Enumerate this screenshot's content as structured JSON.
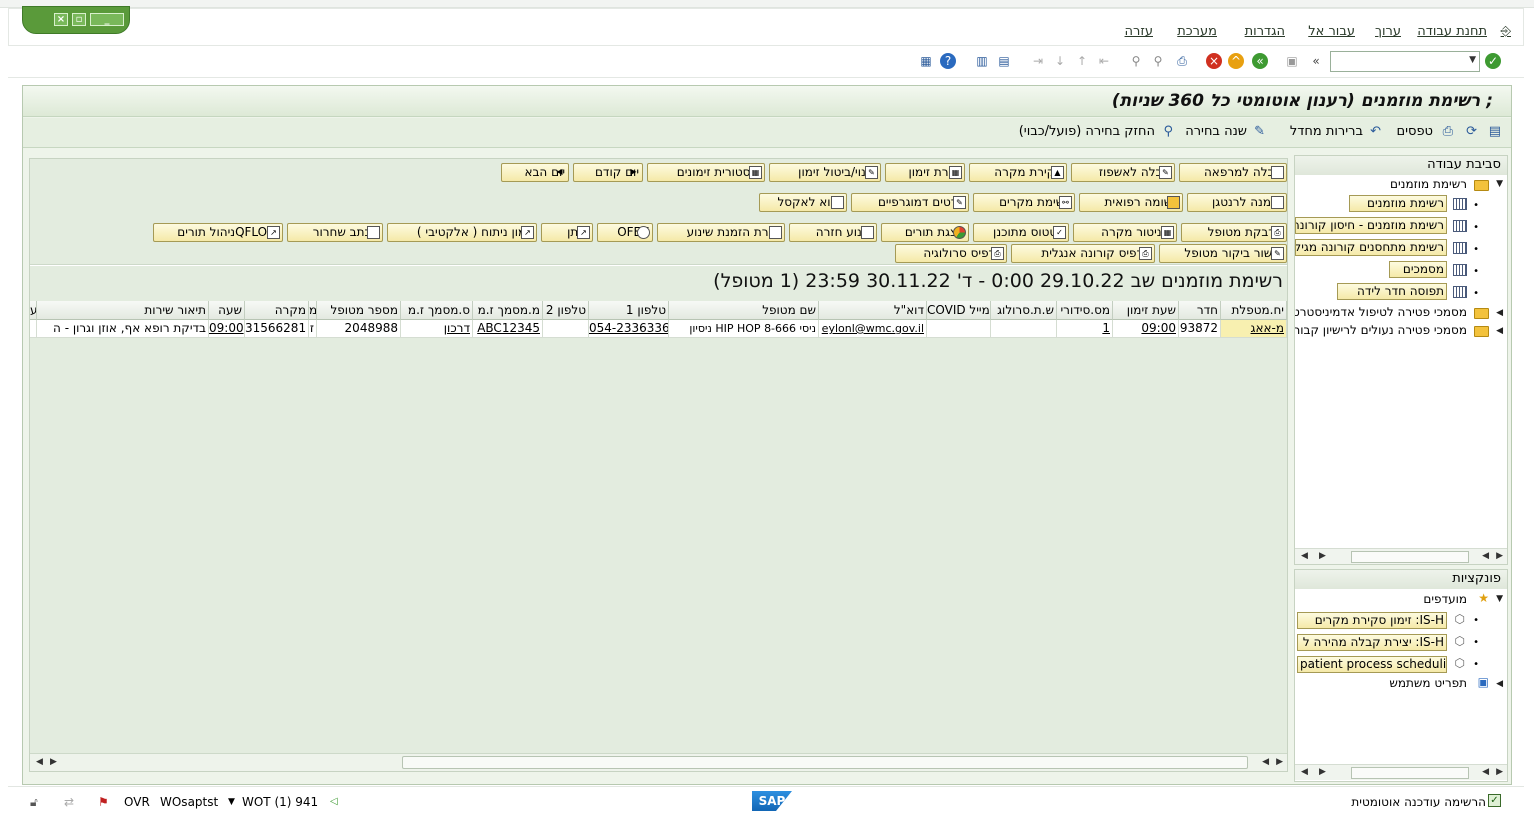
{
  "menu": {
    "items": [
      "תחנת עבודה",
      "ערוך",
      "עבור אל",
      "הגדרות",
      "מערכת",
      "עזרה"
    ]
  },
  "title": "רשימת מוזמנים (רענון אוטומטי כל 360 שניות)  ;",
  "app_toolbar": {
    "items": [
      "טפסים",
      "ברירות מחדל",
      "שנה בחירה",
      "החזק בחירה (פועל/כבוי)"
    ]
  },
  "buttons": {
    "row1": [
      "קבלה למרפאה",
      "קבלה לאשפוז",
      "סקירת מקרה",
      "יצירת זימון",
      "שינוי/ביטול זימון",
      "היסטורית זימונים",
      "יום קודם",
      "יום הבא"
    ],
    "row2": [
      "הזמנה לרנטגן",
      "רשומה רפואית",
      "רשימת מקרים",
      "פרטים דמוגרפיים",
      "ייצוא לאקסל"
    ],
    "row3": [
      "מדבקת מטופל",
      "מוניטור מקרה",
      "סטטוס מתוכנן",
      "הצגת תורים",
      "שינוע חזרה",
      "יצירת הזמנת שינוע",
      "OFEK",
      "איתן",
      "זימון ניתוח ( אלקטיבי )",
      "מכתב שחרור",
      "QFLOWניהול תורים"
    ],
    "row4": [
      "אישור ביקור מטופל",
      "תדפיס קורונה אנגלית",
      "תדפיס סרולוגיה"
    ]
  },
  "list": {
    "heading": "רשימת מוזמנים שב 29.10.22  0:00 - ד' 30.11.22 23:59 (1  מטופל)",
    "columns": [
      "יח.מטפלת",
      "חדר",
      "שעת זימון",
      "מס.סידורי",
      "ש.ת.סרולוג",
      "COVID מייל",
      "דוא\"ל",
      "שם מטופל",
      "טלפון 1",
      "טלפון 2",
      "מ.מסמך ז.מ",
      "ס.מסמך ז.מ",
      "מספר מטופל",
      "מ",
      "מקרה",
      "שעה",
      "תיאור שירות",
      "ע"
    ],
    "rows": [
      [
        "מ-אאג",
        "93872",
        "09:00",
        "1",
        "",
        "",
        "eylonl@wmc.gov.il",
        "ניסיון HIP HOP ניסי 8-666",
        "054-2336336",
        "",
        "ABC12345",
        "דרכון",
        "2048988",
        "ז",
        "31566281",
        "09:00",
        "בדיקת רופא אף, אוזן וגרון - ה",
        ""
      ]
    ]
  },
  "panel_work": {
    "title": "סביבת עבודה",
    "root": "רשימת מוזמנים",
    "items": [
      "רשימת מוזמנים",
      "רשימת מוזמנים - חיסון קורונה",
      "רשימת מתחסנים קורונה מגיל",
      "מסמכים",
      "תפוסה חדר לידה"
    ],
    "folders": [
      "מסמכי פטירה לטיפול אדמיניסטרטיבי",
      "מסמכי פטירה נעולים לרישיון קבורה"
    ]
  },
  "panel_functions": {
    "title": "פונקציות",
    "favorites": "מועדפים",
    "items": [
      "IS-H: זימון סקירת מקרים",
      "IS-H: יצירת קבלה מהירה ל",
      "patient process scheduling"
    ],
    "user_menu": "תפריט משתמש"
  },
  "status": {
    "session": "WOT (1) 941",
    "client": "WOsaptst",
    "mode": "OVR",
    "sap": "SAP",
    "auto_refresh": "הרשימה עודכנה אוטומטית"
  },
  "colors": {
    "accent": "#5a9a3a",
    "frame_bg": "#eef4ea",
    "button_bg": "#f5e9a8"
  }
}
